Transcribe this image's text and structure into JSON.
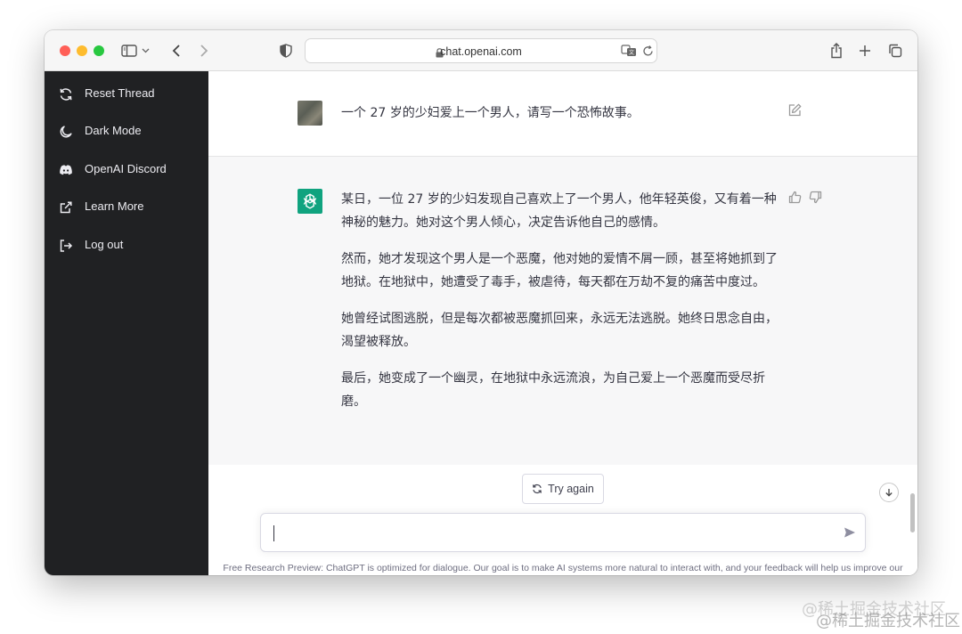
{
  "browser": {
    "url": "chat.openai.com"
  },
  "sidebar": {
    "items": [
      {
        "label": "Reset Thread",
        "icon": "refresh-icon"
      },
      {
        "label": "Dark Mode",
        "icon": "moon-icon"
      },
      {
        "label": "OpenAI Discord",
        "icon": "discord-icon"
      },
      {
        "label": "Learn More",
        "icon": "external-link-icon"
      },
      {
        "label": "Log out",
        "icon": "logout-icon"
      }
    ]
  },
  "conversation": {
    "user_message": "一个 27 岁的少妇爱上一个男人，请写一个恐怖故事。",
    "bot_paragraphs": [
      "某日，一位 27 岁的少妇发现自己喜欢上了一个男人，他年轻英俊，又有着一种神秘的魅力。她对这个男人倾心，决定告诉他自己的感情。",
      "然而，她才发现这个男人是一个恶魔，他对她的爱情不屑一顾，甚至将她抓到了地狱。在地狱中，她遭受了毒手，被虐待，每天都在万劫不复的痛苦中度过。",
      "她曾经试图逃脱，但是每次都被恶魔抓回来，永远无法逃脱。她终日思念自由，渴望被释放。",
      "最后，她变成了一个幽灵，在地狱中永远流浪，为自己爱上一个恶魔而受尽折磨。"
    ]
  },
  "controls": {
    "try_again": "Try again"
  },
  "input": {
    "value": ""
  },
  "footer": {
    "disclaimer": "Free Research Preview: ChatGPT is optimized for dialogue. Our goal is to make AI systems more natural to interact with, and your feedback will help us improve our systems and make them safer."
  },
  "watermark": "@稀土掘金技术社区",
  "colors": {
    "sidebar_bg": "#202123",
    "bot_bg": "#f7f7f8",
    "brand_green": "#10a37f"
  }
}
